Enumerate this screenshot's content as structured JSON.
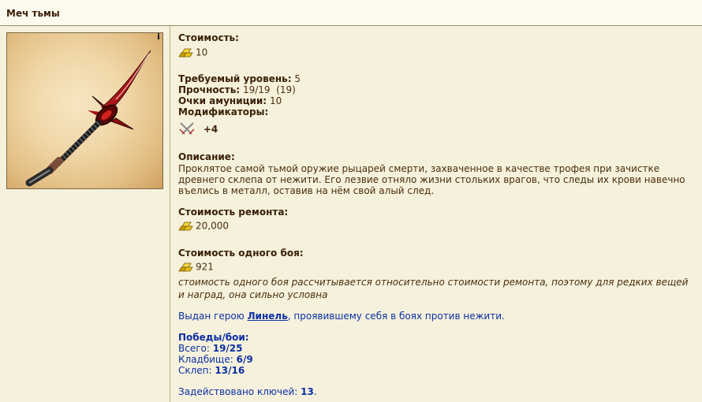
{
  "title": "Меч тьмы",
  "info_icon_label": "i",
  "cost": {
    "label": "Стоимость:",
    "value": "10"
  },
  "stats": {
    "level_label": "Требуемый уровень:",
    "level_value": "5",
    "durability_label": "Прочность:",
    "durability_value": "19/19  (19)",
    "ammo_label": "Очки амуниции:",
    "ammo_value": "10",
    "modifiers_label": "Модификаторы:",
    "modifier_value": "+4"
  },
  "description": {
    "label": "Описание:",
    "text": "Проклятое самой тьмой оружие рыцарей смерти, захваченное в качестве трофея при зачистке древнего склепа от нежити. Его лезвие отняло жизни стольких врагов, что следы их крови навечно въелись в металл, оставив на нём свой алый след."
  },
  "repair": {
    "label": "Стоимость ремонта:",
    "value": "20,000"
  },
  "battle": {
    "label": "Стоимость одного боя:",
    "value": "921",
    "note": "стоимость одного боя рассчитывается относительно стоимости ремонта, поэтому для редких вещей и наград, она сильно условна"
  },
  "hero": {
    "prefix": "Выдан герою ",
    "name": "Линель",
    "suffix": ", проявившему себя в боях против нежити."
  },
  "wins": {
    "label": "Победы/бои:",
    "rows": [
      {
        "label": "Всего: ",
        "value": "19/25"
      },
      {
        "label": "Кладбище: ",
        "value": "6/9"
      },
      {
        "label": "Склеп: ",
        "value": "13/16"
      }
    ]
  },
  "keys": {
    "label": "Задействовано ключей: ",
    "value": "13",
    "suffix": "."
  },
  "colors": {
    "link": "#0c2fa5",
    "text": "#4b2e0e",
    "background": "#f5f1dc"
  },
  "icons": {
    "gold": "gold-bars-icon",
    "modifier": "crossed-swords-icon",
    "info": "info-icon"
  }
}
